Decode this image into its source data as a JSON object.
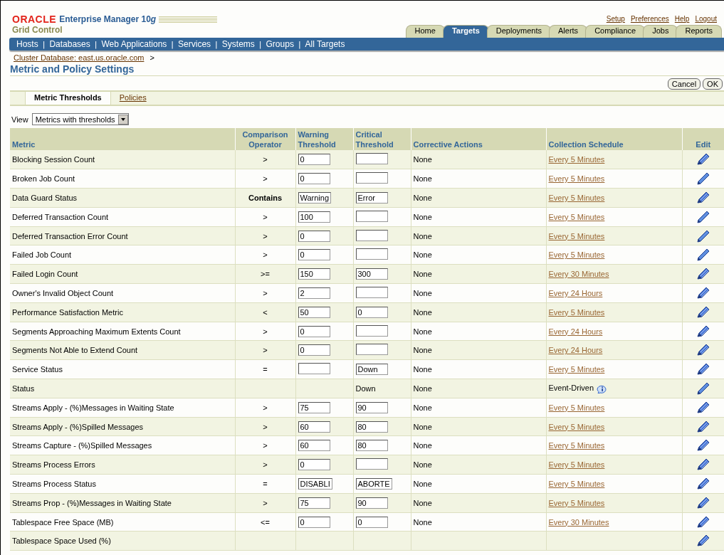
{
  "header": {
    "brand": "ORACLE",
    "product": "Enterprise Manager 10",
    "product_suffix": "g",
    "subtitle": "Grid Control",
    "global_links": [
      "Setup",
      "Preferences",
      "Help",
      "Logout"
    ],
    "tabs": [
      {
        "label": "Home",
        "selected": false
      },
      {
        "label": "Targets",
        "selected": true
      },
      {
        "label": "Deployments",
        "selected": false
      },
      {
        "label": "Alerts",
        "selected": false
      },
      {
        "label": "Compliance",
        "selected": false
      },
      {
        "label": "Jobs",
        "selected": false
      },
      {
        "label": "Reports",
        "selected": false
      }
    ],
    "subnav": {
      "separator": "|",
      "items": [
        "Hosts",
        "Databases",
        "Web Applications",
        "Services",
        "Systems",
        "Groups",
        "All Targets"
      ]
    }
  },
  "breadcrumb": {
    "link": "Cluster Database: east.us.oracle.com",
    "separator": ">"
  },
  "page_title": "Metric and Policy Settings",
  "buttons": [
    "Cancel",
    "OK"
  ],
  "subtabs": [
    {
      "label": "Metric Thresholds",
      "selected": true
    },
    {
      "label": "Policies",
      "selected": false
    }
  ],
  "view": {
    "label": "View",
    "value": "Metrics with thresholds"
  },
  "table": {
    "columns": [
      "Metric",
      "Comparison Operator",
      "Warning Threshold",
      "Critical Threshold",
      "Corrective Actions",
      "Collection Schedule",
      "Edit"
    ],
    "rows": [
      {
        "metric": "Blocking Session Count",
        "operator": ">",
        "warning": {
          "kind": "field",
          "value": "0"
        },
        "critical": {
          "kind": "field"
        },
        "actions": "None",
        "schedule": {
          "kind": "link",
          "text": "Every 5 Minutes"
        },
        "edit": {
          "kind": "multi-pencil"
        }
      },
      {
        "metric": "Broken Job Count",
        "operator": ">",
        "warning": {
          "kind": "field",
          "value": "0"
        },
        "critical": {
          "kind": "field"
        },
        "actions": "None",
        "schedule": {
          "kind": "link",
          "text": "Every 5 Minutes"
        },
        "edit": {
          "kind": "single-pencil"
        }
      },
      {
        "metric": "Data Guard Status",
        "operator": "Contains",
        "operator_bold": true,
        "warning": {
          "kind": "field",
          "value": "Warning"
        },
        "critical": {
          "kind": "field",
          "value": "Error"
        },
        "actions": "None",
        "schedule": {
          "kind": "link",
          "text": "Every 5 Minutes"
        },
        "edit": {
          "kind": "multi-pencil"
        }
      },
      {
        "metric": "Deferred Transaction Count",
        "operator": ">",
        "warning": {
          "kind": "field",
          "value": "100"
        },
        "critical": {
          "kind": "field"
        },
        "actions": "None",
        "schedule": {
          "kind": "link",
          "text": "Every 5 Minutes"
        },
        "edit": {
          "kind": "single-pencil"
        }
      },
      {
        "metric": "Deferred Transaction Error Count",
        "operator": ">",
        "warning": {
          "kind": "field",
          "value": "0"
        },
        "critical": {
          "kind": "field"
        },
        "actions": "None",
        "schedule": {
          "kind": "link",
          "text": "Every 5 Minutes"
        },
        "edit": {
          "kind": "single-pencil"
        }
      },
      {
        "metric": "Failed Job Count",
        "operator": ">",
        "warning": {
          "kind": "field",
          "value": "0"
        },
        "critical": {
          "kind": "field"
        },
        "actions": "None",
        "schedule": {
          "kind": "link",
          "text": "Every 5 Minutes"
        },
        "edit": {
          "kind": "single-pencil"
        }
      },
      {
        "metric": "Failed Login Count",
        "operator": ">=",
        "warning": {
          "kind": "field",
          "value": "150"
        },
        "critical": {
          "kind": "field",
          "value": "300"
        },
        "actions": "None",
        "schedule": {
          "kind": "link",
          "text": "Every 30 Minutes"
        },
        "edit": {
          "kind": "multi-pencil"
        }
      },
      {
        "metric": "Owner's Invalid Object Count",
        "operator": ">",
        "warning": {
          "kind": "field",
          "value": "2"
        },
        "critical": {
          "kind": "field"
        },
        "actions": "None",
        "schedule": {
          "kind": "link",
          "text": "Every 24 Hours"
        },
        "edit": {
          "kind": "multi-pencil"
        }
      },
      {
        "metric": "Performance Satisfaction Metric",
        "operator": "<",
        "warning": {
          "kind": "field",
          "value": "50"
        },
        "critical": {
          "kind": "field",
          "value": "0"
        },
        "actions": "None",
        "schedule": {
          "kind": "link",
          "text": "Every 5 Minutes"
        },
        "edit": {
          "kind": "multi-pencil"
        }
      },
      {
        "metric": "Segments Approaching Maximum Extents Count",
        "operator": ">",
        "warning": {
          "kind": "field",
          "value": "0"
        },
        "critical": {
          "kind": "field"
        },
        "actions": "None",
        "schedule": {
          "kind": "link",
          "text": "Every 24 Hours"
        },
        "edit": {
          "kind": "multi-pencil"
        }
      },
      {
        "metric": "Segments Not Able to Extend Count",
        "operator": ">",
        "warning": {
          "kind": "field",
          "value": "0"
        },
        "critical": {
          "kind": "field"
        },
        "actions": "None",
        "schedule": {
          "kind": "link",
          "text": "Every 24 Hours"
        },
        "edit": {
          "kind": "multi-pencil"
        }
      },
      {
        "metric": "Service Status",
        "operator": "=",
        "warning": {
          "kind": "field"
        },
        "critical": {
          "kind": "field",
          "value": "Down"
        },
        "actions": "None",
        "schedule": {
          "kind": "link",
          "text": "Every 5 Minutes"
        },
        "edit": {
          "kind": "multi-pencil"
        }
      },
      {
        "metric": "Status",
        "critical": {
          "kind": "text",
          "value": "Down"
        },
        "actions": "None",
        "schedule": {
          "kind": "text",
          "text": "Event-Driven",
          "info": true
        },
        "edit": {
          "kind": "single-pencil"
        }
      },
      {
        "metric": "Streams Apply - (%)Messages in Waiting State",
        "operator": ">",
        "warning": {
          "kind": "field",
          "value": "75"
        },
        "critical": {
          "kind": "field",
          "value": "90"
        },
        "actions": "None",
        "schedule": {
          "kind": "link",
          "text": "Every 5 Minutes"
        },
        "edit": {
          "kind": "multi-pencil"
        }
      },
      {
        "metric": "Streams Apply - (%)Spilled Messages",
        "operator": ">",
        "warning": {
          "kind": "field",
          "value": "60"
        },
        "critical": {
          "kind": "field",
          "value": "80"
        },
        "actions": "None",
        "schedule": {
          "kind": "link",
          "text": "Every 5 Minutes"
        },
        "edit": {
          "kind": "multi-pencil"
        }
      },
      {
        "metric": "Streams Capture - (%)Spilled Messages",
        "operator": ">",
        "warning": {
          "kind": "field",
          "value": "60"
        },
        "critical": {
          "kind": "field",
          "value": "80"
        },
        "actions": "None",
        "schedule": {
          "kind": "link",
          "text": "Every 5 Minutes"
        },
        "edit": {
          "kind": "multi-pencil"
        }
      },
      {
        "metric": "Streams Process Errors",
        "operator": ">",
        "warning": {
          "kind": "field",
          "value": "0"
        },
        "critical": {
          "kind": "field"
        },
        "actions": "None",
        "schedule": {
          "kind": "link",
          "text": "Every 5 Minutes"
        },
        "edit": {
          "kind": "multi-pencil"
        }
      },
      {
        "metric": "Streams Process Status",
        "operator": "=",
        "warning": {
          "kind": "field",
          "value": "DISABLI"
        },
        "critical": {
          "kind": "field",
          "value": "ABORTE"
        },
        "actions": "None",
        "schedule": {
          "kind": "link",
          "text": "Every 5 Minutes"
        },
        "edit": {
          "kind": "multi-pencil"
        }
      },
      {
        "metric": "Streams Prop - (%)Messages in Waiting State",
        "operator": ">",
        "warning": {
          "kind": "field",
          "value": "75"
        },
        "critical": {
          "kind": "field",
          "value": "90"
        },
        "actions": "None",
        "schedule": {
          "kind": "link",
          "text": "Every 5 Minutes"
        },
        "edit": {
          "kind": "multi-pencil"
        }
      },
      {
        "metric": "Tablespace Free Space (MB)",
        "operator": "<=",
        "warning": {
          "kind": "field",
          "value": "0"
        },
        "critical": {
          "kind": "field",
          "value": "0"
        },
        "actions": "None",
        "schedule": {
          "kind": "link",
          "text": "Every 30 Minutes"
        },
        "edit": {
          "kind": "multi-pencil"
        }
      },
      {
        "metric": "Tablespace Space Used (%)",
        "edit": {
          "kind": "multi-pencil"
        }
      }
    ]
  }
}
